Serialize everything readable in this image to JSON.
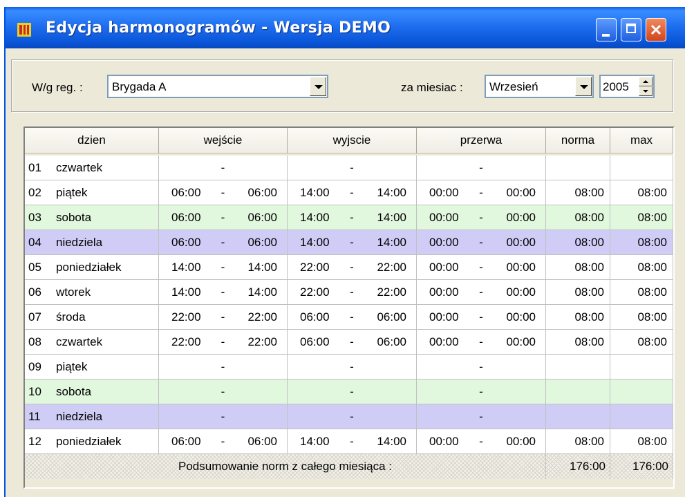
{
  "window": {
    "title": "Edycja harmonogramów - Wersja DEMO"
  },
  "filters": {
    "reg_label": "W/g reg. :",
    "reg_value": "Brygada A",
    "month_label": "za miesiac :",
    "month_value": "Wrzesień",
    "year_value": "2005"
  },
  "table": {
    "headers": [
      "dzien",
      "wejście",
      "wyjscie",
      "przerwa",
      "norma",
      "max"
    ],
    "rows": [
      {
        "n": "01",
        "day": "czwartek",
        "wej": [
          "",
          "-",
          ""
        ],
        "wyj": [
          "",
          "-",
          ""
        ],
        "prz": [
          "",
          "-",
          ""
        ],
        "norma": "",
        "max": "",
        "color": "white"
      },
      {
        "n": "02",
        "day": "piątek",
        "wej": [
          "06:00",
          "-",
          "06:00"
        ],
        "wyj": [
          "14:00",
          "-",
          "14:00"
        ],
        "prz": [
          "00:00",
          "-",
          "00:00"
        ],
        "norma": "08:00",
        "max": "08:00",
        "color": "white"
      },
      {
        "n": "03",
        "day": "sobota",
        "wej": [
          "06:00",
          "-",
          "06:00"
        ],
        "wyj": [
          "14:00",
          "-",
          "14:00"
        ],
        "prz": [
          "00:00",
          "-",
          "00:00"
        ],
        "norma": "08:00",
        "max": "08:00",
        "color": "green"
      },
      {
        "n": "04",
        "day": "niedziela",
        "wej": [
          "06:00",
          "-",
          "06:00"
        ],
        "wyj": [
          "14:00",
          "-",
          "14:00"
        ],
        "prz": [
          "00:00",
          "-",
          "00:00"
        ],
        "norma": "08:00",
        "max": "08:00",
        "color": "blue"
      },
      {
        "n": "05",
        "day": "poniedziałek",
        "wej": [
          "14:00",
          "-",
          "14:00"
        ],
        "wyj": [
          "22:00",
          "-",
          "22:00"
        ],
        "prz": [
          "00:00",
          "-",
          "00:00"
        ],
        "norma": "08:00",
        "max": "08:00",
        "color": "white"
      },
      {
        "n": "06",
        "day": "wtorek",
        "wej": [
          "14:00",
          "-",
          "14:00"
        ],
        "wyj": [
          "22:00",
          "-",
          "22:00"
        ],
        "prz": [
          "00:00",
          "-",
          "00:00"
        ],
        "norma": "08:00",
        "max": "08:00",
        "color": "white"
      },
      {
        "n": "07",
        "day": "środa",
        "wej": [
          "22:00",
          "-",
          "22:00"
        ],
        "wyj": [
          "06:00",
          "-",
          "06:00"
        ],
        "prz": [
          "00:00",
          "-",
          "00:00"
        ],
        "norma": "08:00",
        "max": "08:00",
        "color": "white"
      },
      {
        "n": "08",
        "day": "czwartek",
        "wej": [
          "22:00",
          "-",
          "22:00"
        ],
        "wyj": [
          "06:00",
          "-",
          "06:00"
        ],
        "prz": [
          "00:00",
          "-",
          "00:00"
        ],
        "norma": "08:00",
        "max": "08:00",
        "color": "white"
      },
      {
        "n": "09",
        "day": "piątek",
        "wej": [
          "",
          "-",
          ""
        ],
        "wyj": [
          "",
          "-",
          ""
        ],
        "prz": [
          "",
          "-",
          ""
        ],
        "norma": "",
        "max": "",
        "color": "white"
      },
      {
        "n": "10",
        "day": "sobota",
        "wej": [
          "",
          "-",
          ""
        ],
        "wyj": [
          "",
          "-",
          ""
        ],
        "prz": [
          "",
          "-",
          ""
        ],
        "norma": "",
        "max": "",
        "color": "green"
      },
      {
        "n": "11",
        "day": "niedziela",
        "wej": [
          "",
          "-",
          ""
        ],
        "wyj": [
          "",
          "-",
          ""
        ],
        "prz": [
          "",
          "-",
          ""
        ],
        "norma": "",
        "max": "",
        "color": "blue"
      },
      {
        "n": "12",
        "day": "poniedziałek",
        "wej": [
          "06:00",
          "-",
          "06:00"
        ],
        "wyj": [
          "14:00",
          "-",
          "14:00"
        ],
        "prz": [
          "00:00",
          "-",
          "00:00"
        ],
        "norma": "08:00",
        "max": "08:00",
        "color": "white"
      }
    ],
    "summary": {
      "label": "Podsumowanie norm z całego miesiąca :",
      "norma": "176:00",
      "max": "176:00"
    }
  },
  "colors": {
    "titlebar": "#1f6ff0",
    "row_green": "#e2f8de",
    "row_blue": "#cfcdf6",
    "close_button": "#d2451d"
  }
}
